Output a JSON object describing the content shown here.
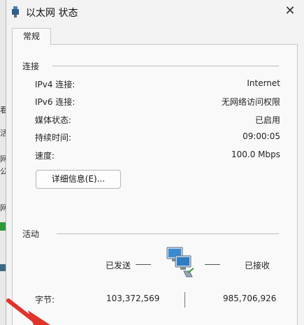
{
  "window": {
    "title": "以太网 状态",
    "close_glyph": "✕"
  },
  "tabs": [
    {
      "label": "常规"
    }
  ],
  "background_fragments": [
    "看",
    "活",
    "网",
    "公",
    "网"
  ],
  "connection": {
    "title": "连接",
    "rows": [
      {
        "label": "IPv4 连接:",
        "value": "Internet"
      },
      {
        "label": "IPv6 连接:",
        "value": "无网络访问权限"
      },
      {
        "label": "媒体状态:",
        "value": "已启用"
      },
      {
        "label": "持续时间:",
        "value": "09:00:05"
      },
      {
        "label": "速度:",
        "value": "100.0 Mbps"
      }
    ],
    "details_button": "详细信息(E)..."
  },
  "activity": {
    "title": "活动",
    "sent_label": "已发送",
    "received_label": "已接收",
    "bytes_label": "字节:",
    "bytes_sent": "103,372,569",
    "bytes_received": "985,706,926"
  },
  "icons": {
    "title_icon": "network-adapter-icon",
    "activity_icon": "network-computers-icon",
    "close_icon": "close-icon",
    "arrow_icon": "red-arrow-icon"
  },
  "colors": {
    "arrow": "#e0332a",
    "dialog_bg": "#f3f3f3",
    "panel_bg": "#f9f9f9"
  }
}
